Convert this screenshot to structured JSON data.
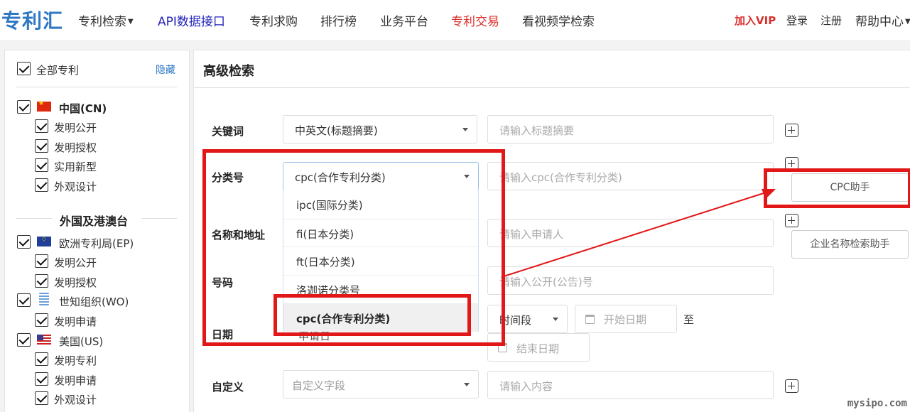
{
  "nav": {
    "logo": "专利汇",
    "items": [
      {
        "label": "专利检索"
      },
      {
        "label": "API数据接口"
      },
      {
        "label": "专利求购"
      },
      {
        "label": "排行榜"
      },
      {
        "label": "业务平台"
      },
      {
        "label": "专利交易"
      },
      {
        "label": "看视频学检索"
      }
    ],
    "right": {
      "vip": "加入VIP",
      "login": "登录",
      "register": "注册",
      "help": "帮助中心"
    }
  },
  "sidebar": {
    "all_label": "全部专利",
    "hide_label": "隐藏",
    "cn": {
      "label": "中国(CN)",
      "subs": [
        "发明公开",
        "发明授权",
        "实用新型",
        "外观设计"
      ]
    },
    "foreign_heading": "外国及港澳台",
    "ep": {
      "label": "欧洲专利局(EP)",
      "subs": [
        "发明公开",
        "发明授权"
      ]
    },
    "wo": {
      "label": "世知组织(WO)",
      "subs": [
        "发明申请"
      ]
    },
    "us": {
      "label": "美国(US)",
      "subs": [
        "发明专利",
        "发明申请",
        "外观设计"
      ]
    }
  },
  "main": {
    "title": "高级检索",
    "keyword": {
      "label": "关键词",
      "select": "中英文(标题摘要)",
      "placeholder": "请输入标题摘要"
    },
    "classification": {
      "label": "分类号",
      "select": "cpc(合作专利分类)",
      "placeholder": "请输入cpc(合作专利分类)",
      "helper": "CPC助手"
    },
    "name_address": {
      "label": "名称和地址",
      "placeholder": "请输入申请人",
      "helper": "企业名称检索助手"
    },
    "number": {
      "label": "号码",
      "placeholder": "请输入公开(公告)号"
    },
    "date": {
      "label": "日期",
      "period": "时间段",
      "start": "开始日期",
      "to": "至",
      "end": "结束日期",
      "partial": "申请日"
    },
    "custom": {
      "label": "自定义",
      "select": "自定义字段",
      "placeholder": "请输入内容"
    }
  },
  "dropdown": {
    "options": [
      "ipc(国际分类)",
      "fi(日本分类)",
      "ft(日本分类)",
      "洛迦诺分类号",
      "cpc(合作专利分类)"
    ],
    "selected": "cpc(合作专利分类)"
  },
  "watermark": "mysipo.com",
  "colors": {
    "accent": "#2f78c4",
    "annotation": "#e21717",
    "highlight": "#d9302c"
  }
}
